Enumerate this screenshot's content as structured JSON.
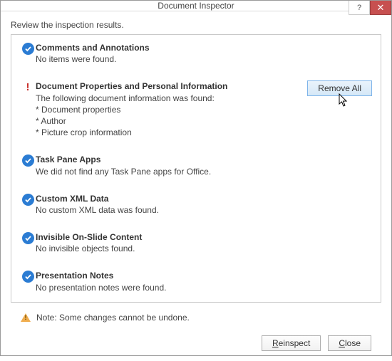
{
  "window": {
    "title": "Document Inspector"
  },
  "intro": "Review the inspection results.",
  "sections": [
    {
      "status": "ok",
      "title": "Comments and Annotations",
      "desc": "No items were found."
    },
    {
      "status": "warn",
      "title": "Document Properties and Personal Information",
      "desc": "The following document information was found:",
      "bullets": [
        "Document properties",
        "Author",
        "Picture crop information"
      ],
      "action_label": "Remove All"
    },
    {
      "status": "ok",
      "title": "Task Pane Apps",
      "desc": "We did not find any Task Pane apps for Office."
    },
    {
      "status": "ok",
      "title": "Custom XML Data",
      "desc": "No custom XML data was found."
    },
    {
      "status": "ok",
      "title": "Invisible On-Slide Content",
      "desc": "No invisible objects found."
    },
    {
      "status": "ok",
      "title": "Presentation Notes",
      "desc": "No presentation notes were found."
    }
  ],
  "note": "Note: Some changes cannot be undone.",
  "buttons": {
    "reinspect_prefix": "R",
    "reinspect_rest": "einspect",
    "close_prefix": "C",
    "close_rest": "lose"
  }
}
